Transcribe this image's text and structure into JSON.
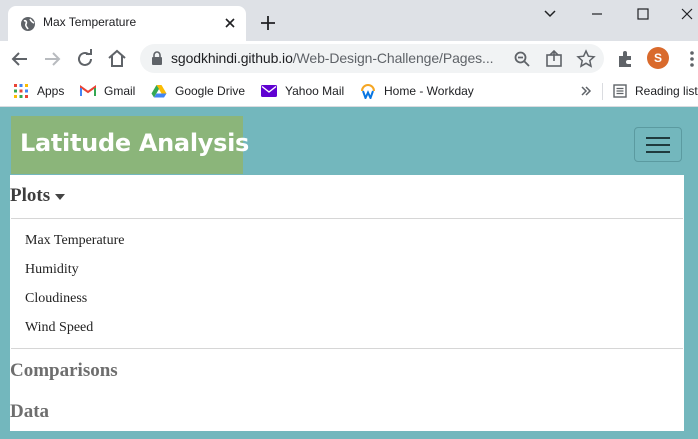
{
  "browser": {
    "tab": {
      "title": "Max Temperature"
    },
    "address_bar": {
      "host": "sgodkhindi.github.io",
      "path": "/Web-Design-Challenge/Pages..."
    },
    "profile": {
      "initial": "S"
    },
    "bookmarks": [
      {
        "label": "Apps",
        "icon": "apps-grid-icon"
      },
      {
        "label": "Gmail",
        "icon": "gmail-icon"
      },
      {
        "label": "Google Drive",
        "icon": "google-drive-icon"
      },
      {
        "label": "Yahoo Mail",
        "icon": "yahoo-mail-icon"
      },
      {
        "label": "Home - Workday",
        "icon": "workday-icon"
      }
    ],
    "reading_list": {
      "label": "Reading list"
    }
  },
  "page": {
    "brand": "Latitude Analysis",
    "nav": {
      "plots": {
        "label": "Plots",
        "items": [
          "Max Temperature",
          "Humidity",
          "Cloudiness",
          "Wind Speed"
        ]
      },
      "comparisons": {
        "label": "Comparisons"
      },
      "data": {
        "label": "Data"
      }
    }
  },
  "colors": {
    "page_background": "#73b7bd",
    "brand_background": "#8bb57a",
    "active_nav_text": "#3d3d3d",
    "inactive_nav_text": "#6e6e6e"
  }
}
